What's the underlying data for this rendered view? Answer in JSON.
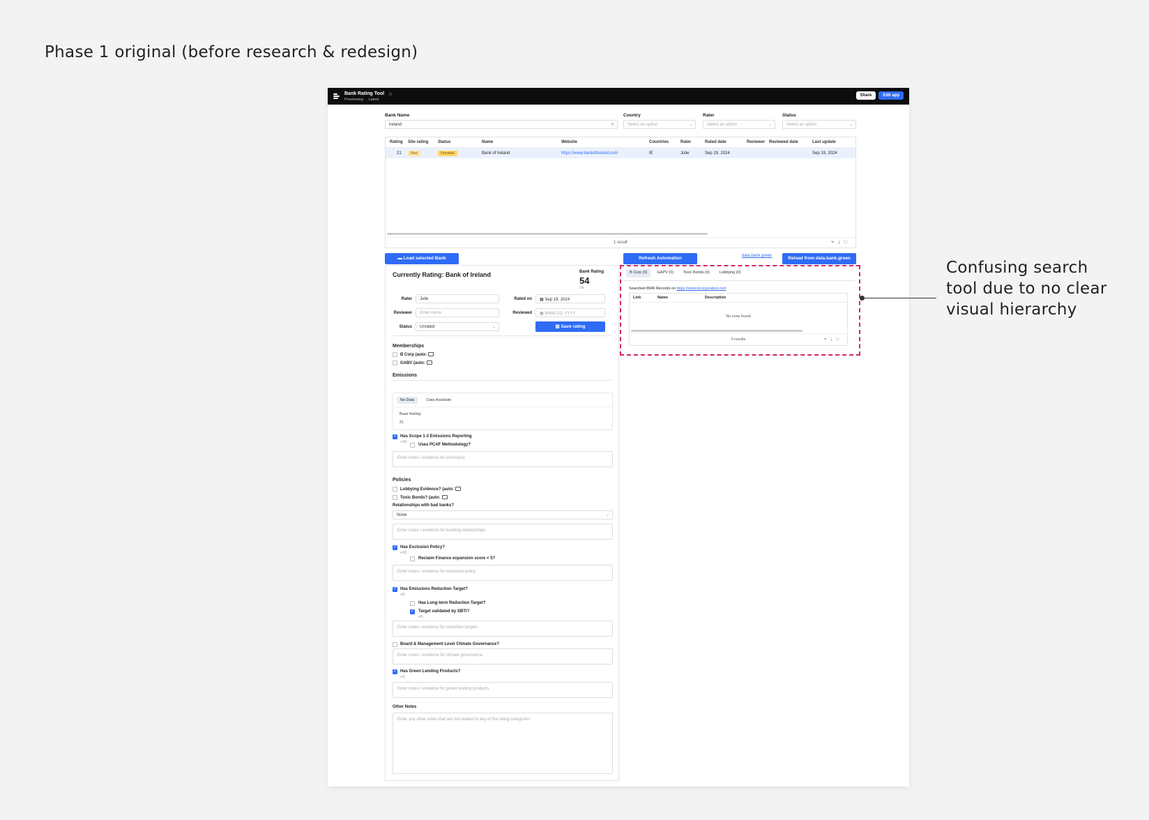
{
  "caption": "Phase 1 original (before research & redesign)",
  "annotation": "Confusing search tool due to no clear visual hierarchy",
  "app": {
    "title": "Bank Rating Tool",
    "sub_previewing": "Previewing",
    "sub_latest": "Latest",
    "share_label": "Share",
    "edit_label": "Edit app"
  },
  "filters": {
    "bank_name_label": "Bank Name",
    "bank_name_value": "ireland",
    "country_label": "Country",
    "rater_label": "Rater",
    "status_label": "Status",
    "placeholder": "Select an option"
  },
  "table": {
    "headers": [
      "Rating",
      "Site rating",
      "Status",
      "Name",
      "Website",
      "Countries",
      "Rater",
      "Rated date",
      "Reviewer",
      "Reviewed date",
      "Last update"
    ],
    "row": {
      "rating": "21",
      "site_rating": "Bad",
      "status": "Unrated",
      "name": "Bank of Ireland",
      "website": "https://www.bankofireland.com",
      "countries": "IE",
      "rater": "Julie",
      "rated_date": "Sep 19, 2024",
      "reviewer": "",
      "reviewed_date": "",
      "last_update": "Sep 19, 2024"
    },
    "footer": "1 result"
  },
  "actions": {
    "load_label": "Load selected Bank",
    "refresh_label": "Refresh Automation",
    "data_link": "data.bank.green",
    "reload_label": "Reload from data.bank.green"
  },
  "rating": {
    "title": "Currently Rating: Bank of Ireland",
    "bank_rating_label": "Bank Rating",
    "bank_rating_value": "54",
    "bank_rating_sub": "Ok",
    "rater_label": "Rater",
    "rater_value": "Julie",
    "reviewer_label": "Reviewer",
    "reviewer_placeholder": "Enter name",
    "status_label": "Status",
    "status_value": "Unrated",
    "rated_on_label": "Rated on",
    "rated_on_value": "Sep 19, 2024",
    "reviewed_label": "Reviewed",
    "reviewed_placeholder": "MMM DD, YYYY",
    "save_label": "Save rating"
  },
  "memberships": {
    "title": "Memberships",
    "bcorp": "B Corp (auto:",
    "gabv": "GABV (auto:"
  },
  "emissions": {
    "title": "Emissions",
    "tab_no_data": "No Data",
    "tab_data_available": "Data Available",
    "base_rating_label": "Base Rating:",
    "base_rating_value": "21",
    "scope_label": "Has Scope 1-3 Emissions Reporting",
    "scope_points": "+10",
    "pcaf_label": "Uses PCAF Methodology?",
    "notes_placeholder": "Enter notes / evidence for emissions"
  },
  "policies": {
    "title": "Policies",
    "lobbying": "Lobbying Evidence? (auto:",
    "toxic": "Toxic Bonds? (auto:",
    "relationships_label": "Relationships with bad banks?",
    "relationships_value": "None",
    "relationships_notes": "Enter notes / evidence for banking relationships",
    "exclusion_label": "Has Exclusion Policy?",
    "exclusion_points": "+10",
    "reclaim_label": "Reclaim Finance expansion score < 5?",
    "exclusion_notes": "Enter notes / evidence for exclusion policy",
    "reduction_label": "Has Emissions Reduction Target?",
    "reduction_points": "+5",
    "longterm_label": "Has Long-term Reduction Target?",
    "sbti_label": "Target validated by SBTi?",
    "sbti_points": "+5",
    "reduction_notes": "Enter notes / evidence for reduction targets",
    "governance_label": "Board & Management Level Climate Governance?",
    "governance_notes": "Enter notes / evidence for climate governance",
    "green_label": "Has Green Lending Products?",
    "green_points": "+3",
    "green_notes": "Enter notes / evidence for green lending products"
  },
  "other_notes": {
    "title": "Other Notes",
    "placeholder": "Enter any other notes that are not related to any of the rating categories"
  },
  "search": {
    "tabs": [
      "B Corp (0)",
      "GAPV (0)",
      "Toxic Bonds (0)",
      "Lobbying (0)"
    ],
    "info_prefix": "Searched 8946 Records on",
    "info_link": "https://www.bcorporation.net/",
    "headers": [
      "Link",
      "Name",
      "Description"
    ],
    "empty": "No rows found",
    "footer": "0 results"
  },
  "colors": {
    "accent": "#2f6cf5",
    "highlight": "#d6265a",
    "topbar": "#0d0d0d"
  }
}
